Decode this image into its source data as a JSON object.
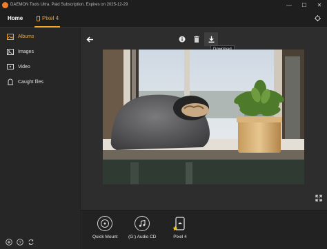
{
  "titlebar": {
    "title": "DAEMON Tools Ultra. Paid Subscription. Expires on 2025-12-29",
    "minimize": "—",
    "maximize": "☐",
    "close": "✕"
  },
  "nav": {
    "home": "Home",
    "device": "Pixel 4",
    "right_icon": "sync-icon"
  },
  "sidebar": {
    "items": [
      {
        "label": "Albums",
        "icon": "albums-icon",
        "active": true
      },
      {
        "label": "Images",
        "icon": "image-icon",
        "active": false
      },
      {
        "label": "Video",
        "icon": "video-icon",
        "active": false
      },
      {
        "label": "Caught files",
        "icon": "caught-files-icon",
        "active": false
      }
    ],
    "bottom_icons": [
      "add-icon",
      "help-icon",
      "refresh-icon"
    ]
  },
  "toolbar": {
    "back": "back-arrow-icon",
    "info": "info-icon",
    "delete": "trash-icon",
    "download": "download-icon",
    "tooltip": "Download"
  },
  "dock": {
    "items": [
      {
        "label": "Quick Mount",
        "icon": "disc-icon"
      },
      {
        "label": "(G:) Audio CD",
        "icon": "music-icon"
      },
      {
        "label": "Pixel 4",
        "icon": "android-phone-icon"
      }
    ]
  },
  "colors": {
    "accent": "#f5a623",
    "background": "#2b2b2b",
    "sidebar": "#262626",
    "dock": "#222222"
  }
}
